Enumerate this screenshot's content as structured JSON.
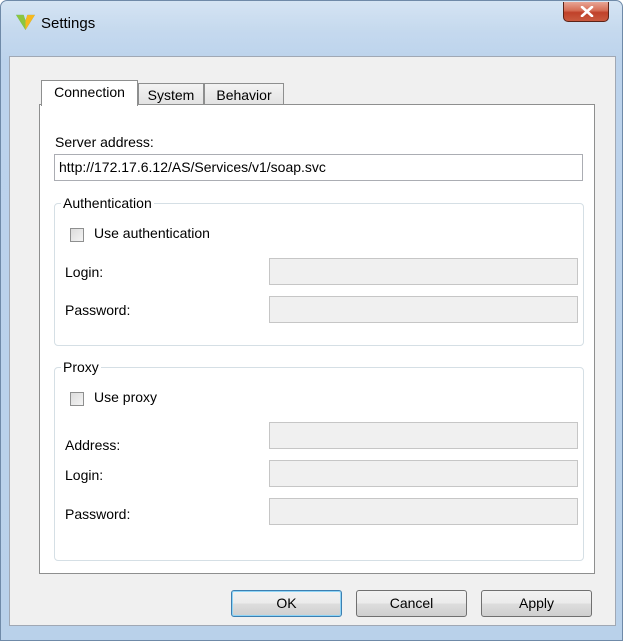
{
  "window": {
    "title": "Settings"
  },
  "tabs": [
    {
      "label": "Connection",
      "active": true
    },
    {
      "label": "System",
      "active": false
    },
    {
      "label": "Behavior",
      "active": false
    }
  ],
  "connection": {
    "server_address_label": "Server address:",
    "server_address_value": "http://172.17.6.12/AS/Services/v1/soap.svc",
    "authentication": {
      "group_title": "Authentication",
      "use_authentication_label": "Use authentication",
      "use_authentication_checked": false,
      "login_label": "Login:",
      "login_value": "",
      "password_label": "Password:",
      "password_value": ""
    },
    "proxy": {
      "group_title": "Proxy",
      "use_proxy_label": "Use proxy",
      "use_proxy_checked": false,
      "address_label": "Address:",
      "address_value": "",
      "login_label": "Login:",
      "login_value": "",
      "password_label": "Password:",
      "password_value": ""
    }
  },
  "buttons": {
    "ok": "OK",
    "cancel": "Cancel",
    "apply": "Apply"
  },
  "icons": {
    "app": "app-logo-icon",
    "close": "close-icon"
  },
  "colors": {
    "close_button": "#c95a3f",
    "title_bar": "#c5d9ee"
  }
}
